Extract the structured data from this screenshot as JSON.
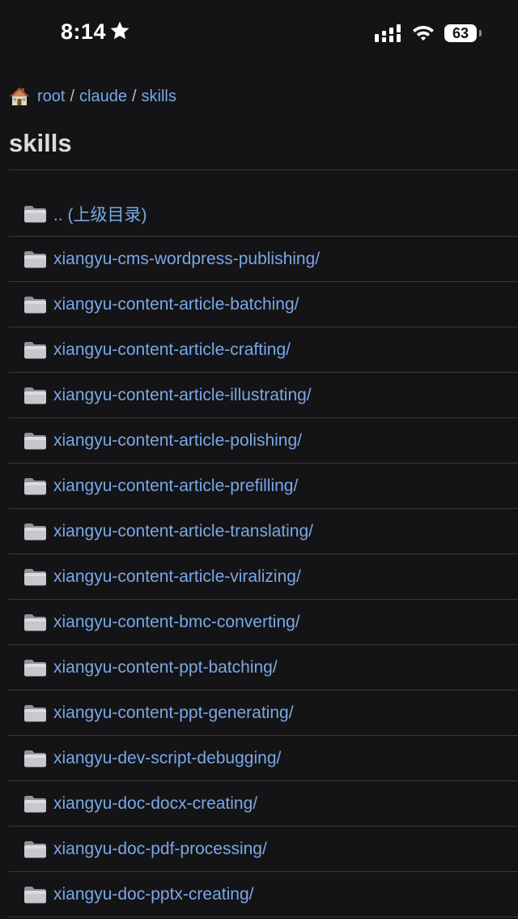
{
  "status_bar": {
    "time": "8:14",
    "battery_level": "63",
    "icons": [
      "star-icon",
      "signal-icon",
      "wifi-icon",
      "battery-icon"
    ]
  },
  "breadcrumb": {
    "icon": "home-icon",
    "items": [
      "root",
      "claude",
      "skills"
    ],
    "separator": "/"
  },
  "page": {
    "title": "skills"
  },
  "file_list": {
    "icon": "folder-icon",
    "entries": [
      ".. (上级目录)",
      "xiangyu-cms-wordpress-publishing/",
      "xiangyu-content-article-batching/",
      "xiangyu-content-article-crafting/",
      "xiangyu-content-article-illustrating/",
      "xiangyu-content-article-polishing/",
      "xiangyu-content-article-prefilling/",
      "xiangyu-content-article-translating/",
      "xiangyu-content-article-viralizing/",
      "xiangyu-content-bmc-converting/",
      "xiangyu-content-ppt-batching/",
      "xiangyu-content-ppt-generating/",
      "xiangyu-dev-script-debugging/",
      "xiangyu-doc-docx-creating/",
      "xiangyu-doc-pdf-processing/",
      "xiangyu-doc-pptx-creating/"
    ]
  }
}
